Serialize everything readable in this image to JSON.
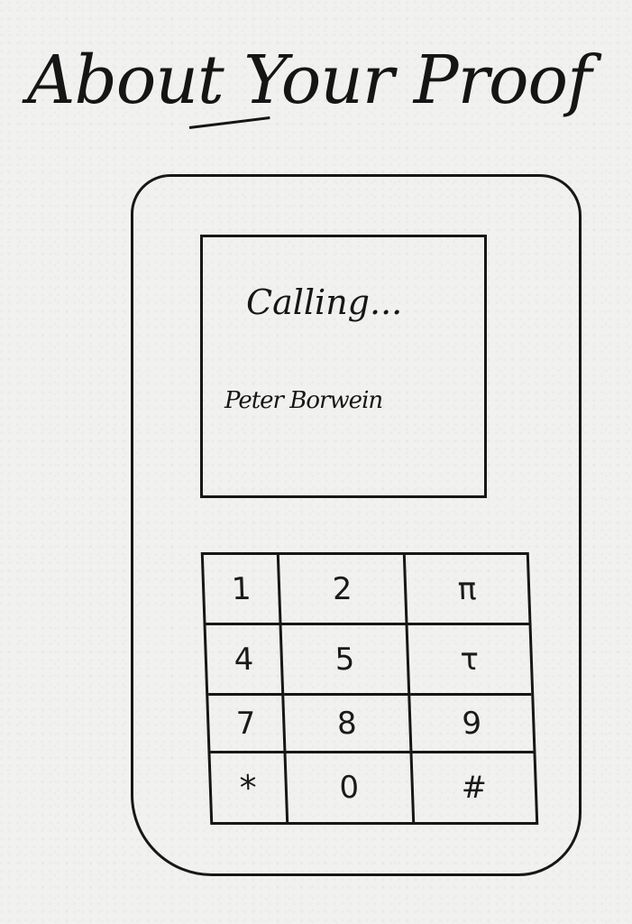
{
  "title": "About Your Proof",
  "screen": {
    "status": "Calling...",
    "contact_name": "Peter Borwein"
  },
  "keypad": {
    "keys": [
      "1",
      "2",
      "π",
      "4",
      "5",
      "τ",
      "7",
      "8",
      "9",
      "*",
      "0",
      "#"
    ]
  }
}
